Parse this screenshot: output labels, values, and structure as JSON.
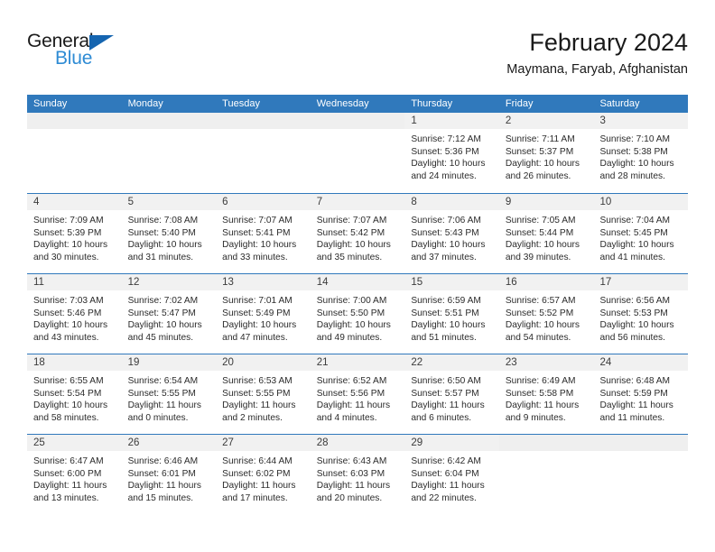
{
  "brand": {
    "name_part1": "General",
    "name_part2": "Blue",
    "triangle_color": "#1565b0",
    "blue_color": "#2e8bd4"
  },
  "header": {
    "title": "February 2024",
    "subtitle": "Maymana, Faryab, Afghanistan"
  },
  "theme": {
    "header_blue": "#3079bc",
    "daynum_strip": "#f1f1f1",
    "empty_strip": "#efefef",
    "text": "#2b2b2b"
  },
  "weekdays": [
    "Sunday",
    "Monday",
    "Tuesday",
    "Wednesday",
    "Thursday",
    "Friday",
    "Saturday"
  ],
  "weeks": [
    [
      {
        "day": "",
        "empty": true
      },
      {
        "day": "",
        "empty": true
      },
      {
        "day": "",
        "empty": true
      },
      {
        "day": "",
        "empty": true
      },
      {
        "day": "1",
        "sunrise": "Sunrise: 7:12 AM",
        "sunset": "Sunset: 5:36 PM",
        "daylight_line1": "Daylight: 10 hours",
        "daylight_line2": "and 24 minutes."
      },
      {
        "day": "2",
        "sunrise": "Sunrise: 7:11 AM",
        "sunset": "Sunset: 5:37 PM",
        "daylight_line1": "Daylight: 10 hours",
        "daylight_line2": "and 26 minutes."
      },
      {
        "day": "3",
        "sunrise": "Sunrise: 7:10 AM",
        "sunset": "Sunset: 5:38 PM",
        "daylight_line1": "Daylight: 10 hours",
        "daylight_line2": "and 28 minutes."
      }
    ],
    [
      {
        "day": "4",
        "sunrise": "Sunrise: 7:09 AM",
        "sunset": "Sunset: 5:39 PM",
        "daylight_line1": "Daylight: 10 hours",
        "daylight_line2": "and 30 minutes."
      },
      {
        "day": "5",
        "sunrise": "Sunrise: 7:08 AM",
        "sunset": "Sunset: 5:40 PM",
        "daylight_line1": "Daylight: 10 hours",
        "daylight_line2": "and 31 minutes."
      },
      {
        "day": "6",
        "sunrise": "Sunrise: 7:07 AM",
        "sunset": "Sunset: 5:41 PM",
        "daylight_line1": "Daylight: 10 hours",
        "daylight_line2": "and 33 minutes."
      },
      {
        "day": "7",
        "sunrise": "Sunrise: 7:07 AM",
        "sunset": "Sunset: 5:42 PM",
        "daylight_line1": "Daylight: 10 hours",
        "daylight_line2": "and 35 minutes."
      },
      {
        "day": "8",
        "sunrise": "Sunrise: 7:06 AM",
        "sunset": "Sunset: 5:43 PM",
        "daylight_line1": "Daylight: 10 hours",
        "daylight_line2": "and 37 minutes."
      },
      {
        "day": "9",
        "sunrise": "Sunrise: 7:05 AM",
        "sunset": "Sunset: 5:44 PM",
        "daylight_line1": "Daylight: 10 hours",
        "daylight_line2": "and 39 minutes."
      },
      {
        "day": "10",
        "sunrise": "Sunrise: 7:04 AM",
        "sunset": "Sunset: 5:45 PM",
        "daylight_line1": "Daylight: 10 hours",
        "daylight_line2": "and 41 minutes."
      }
    ],
    [
      {
        "day": "11",
        "sunrise": "Sunrise: 7:03 AM",
        "sunset": "Sunset: 5:46 PM",
        "daylight_line1": "Daylight: 10 hours",
        "daylight_line2": "and 43 minutes."
      },
      {
        "day": "12",
        "sunrise": "Sunrise: 7:02 AM",
        "sunset": "Sunset: 5:47 PM",
        "daylight_line1": "Daylight: 10 hours",
        "daylight_line2": "and 45 minutes."
      },
      {
        "day": "13",
        "sunrise": "Sunrise: 7:01 AM",
        "sunset": "Sunset: 5:49 PM",
        "daylight_line1": "Daylight: 10 hours",
        "daylight_line2": "and 47 minutes."
      },
      {
        "day": "14",
        "sunrise": "Sunrise: 7:00 AM",
        "sunset": "Sunset: 5:50 PM",
        "daylight_line1": "Daylight: 10 hours",
        "daylight_line2": "and 49 minutes."
      },
      {
        "day": "15",
        "sunrise": "Sunrise: 6:59 AM",
        "sunset": "Sunset: 5:51 PM",
        "daylight_line1": "Daylight: 10 hours",
        "daylight_line2": "and 51 minutes."
      },
      {
        "day": "16",
        "sunrise": "Sunrise: 6:57 AM",
        "sunset": "Sunset: 5:52 PM",
        "daylight_line1": "Daylight: 10 hours",
        "daylight_line2": "and 54 minutes."
      },
      {
        "day": "17",
        "sunrise": "Sunrise: 6:56 AM",
        "sunset": "Sunset: 5:53 PM",
        "daylight_line1": "Daylight: 10 hours",
        "daylight_line2": "and 56 minutes."
      }
    ],
    [
      {
        "day": "18",
        "sunrise": "Sunrise: 6:55 AM",
        "sunset": "Sunset: 5:54 PM",
        "daylight_line1": "Daylight: 10 hours",
        "daylight_line2": "and 58 minutes."
      },
      {
        "day": "19",
        "sunrise": "Sunrise: 6:54 AM",
        "sunset": "Sunset: 5:55 PM",
        "daylight_line1": "Daylight: 11 hours",
        "daylight_line2": "and 0 minutes."
      },
      {
        "day": "20",
        "sunrise": "Sunrise: 6:53 AM",
        "sunset": "Sunset: 5:55 PM",
        "daylight_line1": "Daylight: 11 hours",
        "daylight_line2": "and 2 minutes."
      },
      {
        "day": "21",
        "sunrise": "Sunrise: 6:52 AM",
        "sunset": "Sunset: 5:56 PM",
        "daylight_line1": "Daylight: 11 hours",
        "daylight_line2": "and 4 minutes."
      },
      {
        "day": "22",
        "sunrise": "Sunrise: 6:50 AM",
        "sunset": "Sunset: 5:57 PM",
        "daylight_line1": "Daylight: 11 hours",
        "daylight_line2": "and 6 minutes."
      },
      {
        "day": "23",
        "sunrise": "Sunrise: 6:49 AM",
        "sunset": "Sunset: 5:58 PM",
        "daylight_line1": "Daylight: 11 hours",
        "daylight_line2": "and 9 minutes."
      },
      {
        "day": "24",
        "sunrise": "Sunrise: 6:48 AM",
        "sunset": "Sunset: 5:59 PM",
        "daylight_line1": "Daylight: 11 hours",
        "daylight_line2": "and 11 minutes."
      }
    ],
    [
      {
        "day": "25",
        "sunrise": "Sunrise: 6:47 AM",
        "sunset": "Sunset: 6:00 PM",
        "daylight_line1": "Daylight: 11 hours",
        "daylight_line2": "and 13 minutes."
      },
      {
        "day": "26",
        "sunrise": "Sunrise: 6:46 AM",
        "sunset": "Sunset: 6:01 PM",
        "daylight_line1": "Daylight: 11 hours",
        "daylight_line2": "and 15 minutes."
      },
      {
        "day": "27",
        "sunrise": "Sunrise: 6:44 AM",
        "sunset": "Sunset: 6:02 PM",
        "daylight_line1": "Daylight: 11 hours",
        "daylight_line2": "and 17 minutes."
      },
      {
        "day": "28",
        "sunrise": "Sunrise: 6:43 AM",
        "sunset": "Sunset: 6:03 PM",
        "daylight_line1": "Daylight: 11 hours",
        "daylight_line2": "and 20 minutes."
      },
      {
        "day": "29",
        "sunrise": "Sunrise: 6:42 AM",
        "sunset": "Sunset: 6:04 PM",
        "daylight_line1": "Daylight: 11 hours",
        "daylight_line2": "and 22 minutes."
      },
      {
        "day": "",
        "empty": true
      },
      {
        "day": "",
        "empty": true
      }
    ]
  ]
}
